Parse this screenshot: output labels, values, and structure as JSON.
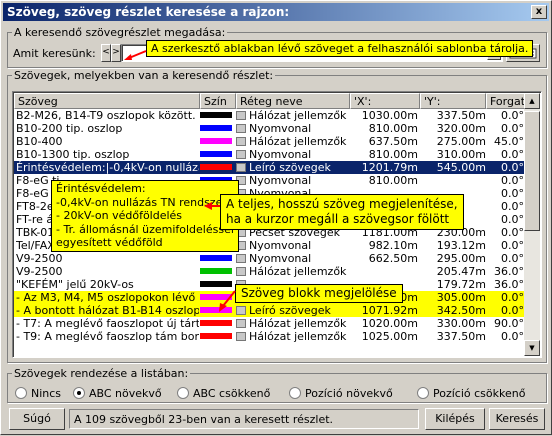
{
  "window": {
    "title": "Szöveg, szöveg részlet keresése a rajzon:",
    "close_glyph": "x"
  },
  "search_group": {
    "legend": "A keresendő szövegrészlet megadása:",
    "label": "Amit keresünk:",
    "prev_btn": "<",
    "next_btn": ">",
    "value": "",
    "tooltip": "A szerkesztő ablakban lévő szöveget a felhasználói sablonba tárolja."
  },
  "results_group": {
    "legend": "Szövegek, melyekben van a keresendő részlet:",
    "columns": [
      "Szöveg",
      "Szín",
      "Réteg neve",
      "'X':",
      "'Y':",
      "Forgat..."
    ],
    "rows": [
      {
        "text": "B2-M26, B14-T9 oszlopok között.",
        "color": "#000000",
        "layer": "Hálózat jellemzők",
        "x": "1030.00m",
        "y": "337.50m",
        "rot": "0.0°",
        "style": ""
      },
      {
        "text": "B10-200 tip. oszlop",
        "color": "#0000ff",
        "layer": "Nyomvonal",
        "x": "810.00m",
        "y": "320.00m",
        "rot": "0.0°",
        "style": ""
      },
      {
        "text": "B10-400",
        "color": "#ff00ff",
        "layer": "Hálózat jellemzők",
        "x": "637.50m",
        "y": "275.00m",
        "rot": "45.0°",
        "style": ""
      },
      {
        "text": "B10-1300 tip. oszlop",
        "color": "#0000ff",
        "layer": "Nyomvonal",
        "x": "810.00m",
        "y": "310.00m",
        "rot": "0.0°",
        "style": ""
      },
      {
        "text": "Érintésvédelem:|-0,4kV-on nullázás ...",
        "color": "#ff0000",
        "layer": "Leíró szövegek",
        "x": "1201.79m",
        "y": "545.00m",
        "rot": "0.0°",
        "style": "sel"
      },
      {
        "text": "F8-eG ti",
        "color": "#0000ff",
        "layer": "Nyomvonal",
        "x": "810.00m",
        "y": "",
        "rot": "0.0°",
        "style": ""
      },
      {
        "text": "F8-eG ti",
        "color": "#0000ff",
        "layer": "Nyomvonal",
        "x": "",
        "y": "",
        "rot": "0.0°",
        "style": ""
      },
      {
        "text": "FT8-2e0",
        "color": "#0000ff",
        "layer": "Nyomvonal",
        "x": "",
        "y": "",
        "rot": "0.0°",
        "style": ""
      },
      {
        "text": "FT-re át",
        "color": "#ff0000",
        "layer": "Hálózat jellemzők",
        "x": "",
        "y": "",
        "rot": "0.0°",
        "style": ""
      },
      {
        "text": "TBK-01",
        "color": "#000000",
        "layer": "Pecsét szövegek",
        "x": "1181.00m",
        "y": "230.00m",
        "rot": "0.0°",
        "style": ""
      },
      {
        "text": "Tel/FAX:206-6547",
        "color": "#ffff00",
        "layer": "Nyomvonal",
        "x": "982.10m",
        "y": "193.12m",
        "rot": "0.0°",
        "style": ""
      },
      {
        "text": "V9-2500",
        "color": "#0000ff",
        "layer": "Nyomvonal",
        "x": "662.50m",
        "y": "295.00m",
        "rot": "0.0°",
        "style": ""
      },
      {
        "text": "V9-2500",
        "color": "#00c000",
        "layer": "Hálózat jellemzők",
        "x": "",
        "y": "205.47m",
        "rot": "36.0°",
        "style": ""
      },
      {
        "text": "\"KEFÉM\" jelű 20kV-os",
        "color": "#000000",
        "layer": "",
        "x": "",
        "y": "179.72m",
        "rot": "36.0°",
        "style": ""
      },
      {
        "text": "- Az M3, M4, M5 oszlopokon lévő lá...",
        "color": "#ff00ff",
        "layer": "Leíró szövegek",
        "x": "1025.00m",
        "y": "305.00m",
        "rot": "0.0°",
        "style": "yel"
      },
      {
        "text": "- A bontott hálózat B1-B14 oszlopok...",
        "color": "#ff00ff",
        "layer": "Leíró szövegek",
        "x": "1071.92m",
        "y": "342.50m",
        "rot": "0.0°",
        "style": "yel"
      },
      {
        "text": "- T7: A meglévő faoszlopot új tártmal",
        "color": "#ff0000",
        "layer": "Hálózat jellemzők",
        "x": "1020.00m",
        "y": "330.00m",
        "rot": "90.0°",
        "style": ""
      },
      {
        "text": "- T9: A meglévő faoszlop tám bontás",
        "color": "#ff0000",
        "layer": "Hálózat jellemzők",
        "x": "1025.00m",
        "y": "337.50m",
        "rot": "0.0°",
        "style": ""
      }
    ],
    "multiline_popup": [
      "Érintésvédelem:",
      "-0,4kV-on nullázás TN rendszer",
      "- 20kV-on védőföldelés",
      "- Tr. állomásnál üzemifoldeléssel",
      "egyesített védőföld"
    ],
    "tooltip_long": [
      "A teljes, hosszú szöveg megjelenítése,",
      "ha a kurzor megáll a szövegsor fölött"
    ],
    "tooltip_block": "Szöveg blokk megjelölése"
  },
  "sort_group": {
    "legend": "Szövegek rendezése a listában:",
    "options": [
      "Nincs",
      "ABC növekvő",
      "ABC csökkenő",
      "Pozíció növekvő",
      "Pozíció csökkenő"
    ],
    "selected_index": 1
  },
  "footer": {
    "help": "Súgó",
    "status": "A 109 szövegből 23-ben van a keresett részlet.",
    "exit": "Kilépés",
    "search": "Keresés"
  }
}
